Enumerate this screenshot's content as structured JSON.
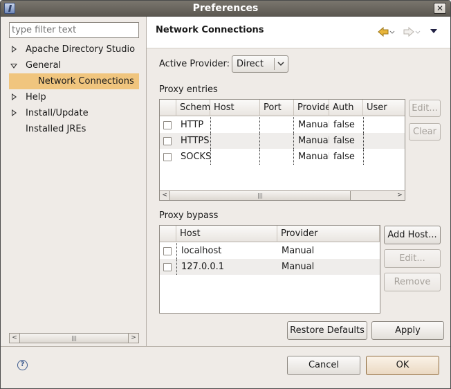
{
  "window": {
    "title": "Preferences"
  },
  "sidebar": {
    "filter_placeholder": "type filter text",
    "items": [
      {
        "label": "Apache Directory Studio",
        "expander": "collapsed"
      },
      {
        "label": "General",
        "expander": "expanded"
      },
      {
        "label": "Network Connections",
        "selected": true
      },
      {
        "label": "Help",
        "expander": "collapsed"
      },
      {
        "label": "Install/Update",
        "expander": "collapsed"
      },
      {
        "label": "Installed JREs"
      }
    ]
  },
  "page": {
    "title": "Network Connections",
    "active_provider_label": "Active Provider:",
    "active_provider_value": "Direct",
    "proxy_entries_label": "Proxy entries",
    "proxy_bypass_label": "Proxy bypass"
  },
  "proxy_entries": {
    "columns": [
      "Schema",
      "Host",
      "Port",
      "Provider",
      "Auth",
      "User"
    ],
    "rows": [
      {
        "schema": "HTTP",
        "host": "",
        "port": "",
        "provider": "Manual",
        "auth": "false",
        "user": ""
      },
      {
        "schema": "HTTPS",
        "host": "",
        "port": "",
        "provider": "Manual",
        "auth": "false",
        "user": ""
      },
      {
        "schema": "SOCKS",
        "host": "",
        "port": "",
        "provider": "Manual",
        "auth": "false",
        "user": ""
      }
    ],
    "edit_label": "Edit...",
    "clear_label": "Clear"
  },
  "proxy_bypass": {
    "columns": [
      "Host",
      "Provider"
    ],
    "rows": [
      {
        "host": "localhost",
        "provider": "Manual"
      },
      {
        "host": "127.0.0.1",
        "provider": "Manual"
      }
    ],
    "add_host_label": "Add Host...",
    "edit_label": "Edit...",
    "remove_label": "Remove"
  },
  "actions": {
    "restore_defaults_label": "Restore Defaults",
    "apply_label": "Apply",
    "cancel_label": "Cancel",
    "ok_label": "OK"
  },
  "icons": {
    "app": "eclipse-app-icon",
    "close": "close-icon",
    "back": "back-arrow-icon",
    "forward": "forward-arrow-icon",
    "view_menu": "view-menu-icon",
    "help": "help-icon"
  },
  "colors": {
    "selection": "#f0c57e",
    "titlebar": "#5b5750",
    "dialog_bg": "#efebe7",
    "back_arrow": "#e8b53a"
  }
}
